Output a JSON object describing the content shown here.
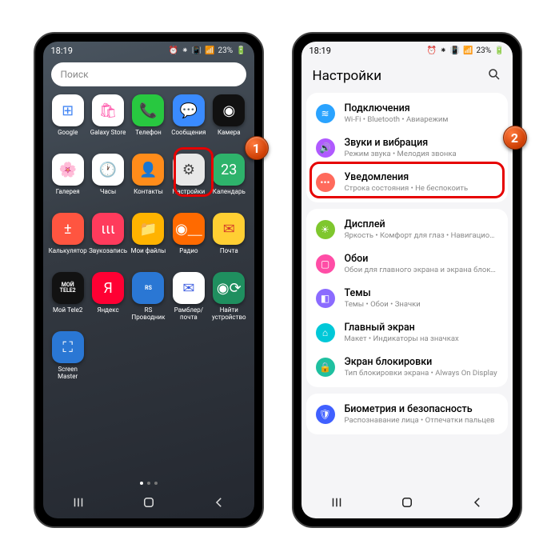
{
  "status": {
    "time": "18:19",
    "alarm": "⏰",
    "bt": "⁕",
    "vib": "📳",
    "sig": "📶",
    "batt_pct": "23%",
    "batt": "🔋"
  },
  "left": {
    "search_placeholder": "Поиск",
    "apps": [
      {
        "label": "Google",
        "bg": "#fff",
        "glyph": "⊞",
        "fg": "#4285f4"
      },
      {
        "label": "Galaxy Store",
        "bg": "#fff",
        "glyph": "🛍",
        "fg": "#ff4da6"
      },
      {
        "label": "Телефон",
        "bg": "#28c840",
        "glyph": "📞",
        "fg": "#fff"
      },
      {
        "label": "Сообщения",
        "bg": "#3a8bff",
        "glyph": "💬",
        "fg": "#fff"
      },
      {
        "label": "Камера",
        "bg": "#111",
        "glyph": "◉",
        "fg": "#fff"
      },
      {
        "label": "Галерея",
        "bg": "#fff",
        "glyph": "🌸",
        "fg": "#ff3b7a"
      },
      {
        "label": "Часы",
        "bg": "#fff",
        "glyph": "🕐",
        "fg": "#333"
      },
      {
        "label": "Контакты",
        "bg": "#ff8c1a",
        "glyph": "👤",
        "fg": "#fff"
      },
      {
        "label": "Настройки",
        "bg": "#e8e8e8",
        "glyph": "⚙",
        "fg": "#444"
      },
      {
        "label": "Календарь",
        "bg": "#2eb36b",
        "glyph": "23",
        "fg": "#fff"
      },
      {
        "label": "Калькулятор",
        "bg": "#ff5540",
        "glyph": "±",
        "fg": "#fff"
      },
      {
        "label": "Звукозапись",
        "bg": "#ff3b5c",
        "glyph": "ιιι",
        "fg": "#fff"
      },
      {
        "label": "Мои файлы",
        "bg": "#ffb300",
        "glyph": "📁",
        "fg": "#fff"
      },
      {
        "label": "Радио",
        "bg": "#ff6a00",
        "glyph": "◉⸏",
        "fg": "#fff"
      },
      {
        "label": "Почта",
        "bg": "#ffcf33",
        "glyph": "✉",
        "fg": "#d43d2a"
      },
      {
        "label": "Мой Tele2",
        "bg": "#121212",
        "glyph": "МОЙ\nTELE2",
        "fg": "#fff",
        "small": true
      },
      {
        "label": "Яндекс",
        "bg": "#ff0033",
        "glyph": "Я",
        "fg": "#fff"
      },
      {
        "label": "RS\nПроводник",
        "bg": "#2a77d4",
        "glyph": "RS",
        "fg": "#fff",
        "small": true
      },
      {
        "label": "Рамблер/\nпочта",
        "bg": "#fff",
        "glyph": "✉",
        "fg": "#4060e0"
      },
      {
        "label": "Найти\nустройство",
        "bg": "#1f8f5f",
        "glyph": "◉⟳",
        "fg": "#fff"
      },
      {
        "label": "Screen\nMaster",
        "bg": "#2a77d4",
        "glyph": "⛶",
        "fg": "#fff"
      }
    ],
    "badge": "1"
  },
  "right": {
    "title": "Настройки",
    "badge": "2",
    "groups": [
      [
        {
          "icon_bg": "#2aa3ff",
          "glyph": "≋",
          "t1": "Подключения",
          "t2": "Wi-Fi • Bluetooth • Авиарежим"
        },
        {
          "icon_bg": "#b05aff",
          "glyph": "🔊",
          "t1": "Звуки и вибрация",
          "t2": "Режим звука • Мелодия звонка"
        },
        {
          "icon_bg": "#ff6a5c",
          "glyph": "•••",
          "t1": "Уведомления",
          "t2": "Строка состояния • Не беспокоить"
        }
      ],
      [
        {
          "icon_bg": "#7fc72e",
          "glyph": "☀",
          "t1": "Дисплей",
          "t2": "Яркость • Комфорт для глаз • Навигационная панель"
        },
        {
          "icon_bg": "#ff4da6",
          "glyph": "▢",
          "t1": "Обои",
          "t2": "Обои для главного экрана и экрана блокировки"
        },
        {
          "icon_bg": "#8b6bff",
          "glyph": "◧",
          "t1": "Темы",
          "t2": "Темы • Обои • Значки"
        },
        {
          "icon_bg": "#00c8d8",
          "glyph": "⌂",
          "t1": "Главный экран",
          "t2": "Макет • Индикаторы на значках"
        },
        {
          "icon_bg": "#1fc0a0",
          "glyph": "🔒",
          "t1": "Экран блокировки",
          "t2": "Тип блокировки экрана • Always On Display"
        }
      ],
      [
        {
          "icon_bg": "#4060ff",
          "glyph": "🛡",
          "t1": "Биометрия и безопасность",
          "t2": "Распознавание лица • Отпечатки пальцев"
        }
      ]
    ]
  },
  "nav": {
    "recent": "|||",
    "home": "○",
    "back": "‹"
  }
}
